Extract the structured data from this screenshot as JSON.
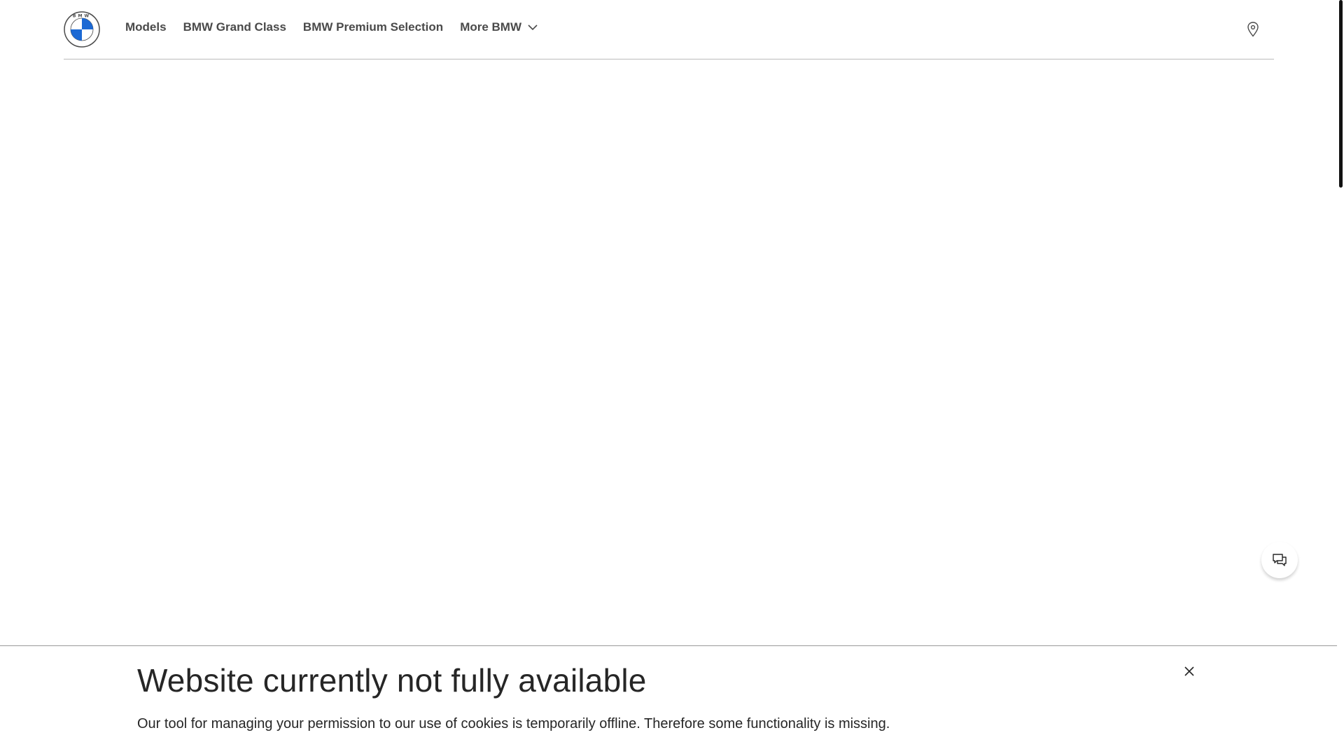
{
  "header": {
    "logo_text": "BMW",
    "nav": [
      {
        "label": "Models"
      },
      {
        "label": "BMW Grand Class"
      },
      {
        "label": "BMW Premium Selection"
      },
      {
        "label": "More BMW"
      }
    ],
    "location_icon": "map-pin-icon"
  },
  "chat": {
    "icon": "chat-bubbles-icon"
  },
  "banner": {
    "title": "Website currently not fully available",
    "text": "Our tool for managing your permission to our use of cookies is temporarily offline. Therefore some functionality is missing.",
    "close_icon": "close-icon"
  },
  "colors": {
    "brand_blue": "#1c69d4",
    "text": "#262626",
    "nav_text": "#4a4a4a",
    "divider": "#bbbbbb"
  }
}
